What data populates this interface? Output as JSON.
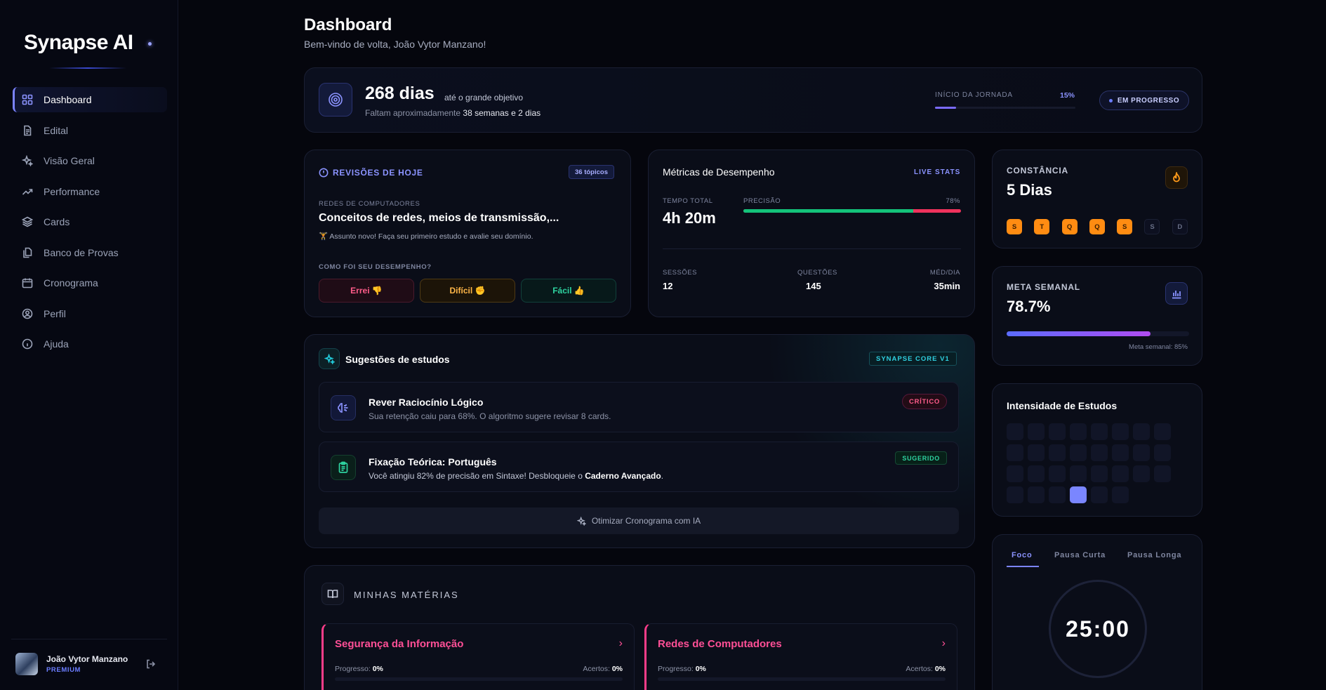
{
  "app": {
    "logo": "Synapse AI"
  },
  "sidebar": {
    "items": [
      {
        "label": "Dashboard",
        "icon": "grid-icon",
        "active": true
      },
      {
        "label": "Edital",
        "icon": "document-icon"
      },
      {
        "label": "Visão Geral",
        "icon": "sparkles-icon"
      },
      {
        "label": "Performance",
        "icon": "trending-up-icon"
      },
      {
        "label": "Cards",
        "icon": "layers-icon"
      },
      {
        "label": "Banco de Provas",
        "icon": "files-icon"
      },
      {
        "label": "Cronograma",
        "icon": "calendar-icon"
      },
      {
        "label": "Perfil",
        "icon": "user-circle-icon"
      },
      {
        "label": "Ajuda",
        "icon": "info-icon"
      }
    ],
    "user": {
      "name": "João Vytor Manzano",
      "tier": "PREMIUM"
    }
  },
  "header": {
    "title": "Dashboard",
    "subtitle": "Bem-vindo de volta, João Vytor Manzano!"
  },
  "goal": {
    "days": "268 dias",
    "until": "até o grande objetivo",
    "remaining_prefix": "Faltam aproximadamente",
    "remaining_value": "38 semanas e 2 dias",
    "journey_label": "INÍCIO DA JORNADA",
    "journey_percent": "15%",
    "journey_fraction": 0.15,
    "status": "EM PROGRESSO"
  },
  "reviews": {
    "title": "REVISÕES DE HOJE",
    "badge": "36 tópicos",
    "area": "REDES DE COMPUTADORES",
    "topic": "Conceitos de redes, meios de transmissão,...",
    "note": "🏋 Assunto novo! Faça seu primeiro estudo e avalie seu domínio.",
    "question": "COMO FOI SEU DESEMPENHO?",
    "buttons": {
      "wrong": "Errei 👎",
      "hard": "Difícil ✊",
      "easy": "Fácil 👍"
    }
  },
  "metrics": {
    "title": "Métricas de Desempenho",
    "live": "LIVE STATS",
    "total_time_label": "TEMPO TOTAL",
    "total_time": "4h 20m",
    "precision_label": "PRECISÃO",
    "precision": "78%",
    "precision_fraction": 0.78,
    "sessions_label": "SESSÕES",
    "sessions": "12",
    "questions_label": "QUESTÕES",
    "questions": "145",
    "avg_label": "MÉD/DIA",
    "avg": "35min"
  },
  "streak": {
    "label": "CONSTÂNCIA",
    "value": "5 Dias",
    "days": [
      {
        "d": "S",
        "done": true
      },
      {
        "d": "T",
        "done": true
      },
      {
        "d": "Q",
        "done": true
      },
      {
        "d": "Q",
        "done": true
      },
      {
        "d": "S",
        "done": true
      },
      {
        "d": "S",
        "done": false
      },
      {
        "d": "D",
        "done": false
      }
    ]
  },
  "weekly_goal": {
    "label": "META SEMANAL",
    "value": "78.7%",
    "fraction": 0.787,
    "note": "Meta semanal: 85%"
  },
  "intensity": {
    "title": "Intensidade de Estudos",
    "cells": [
      0,
      0,
      0,
      0,
      0,
      0,
      0,
      0,
      0,
      0,
      0,
      0,
      0,
      0,
      0,
      0,
      0,
      0,
      0,
      0,
      0,
      0,
      0,
      0,
      0,
      0,
      0,
      1,
      0,
      0
    ]
  },
  "pomodoro": {
    "tabs": [
      "Foco",
      "Pausa Curta",
      "Pausa Longa"
    ],
    "time": "25:00"
  },
  "suggestions": {
    "title": "Sugestões de estudos",
    "badge": "SYNAPSE CORE V1",
    "items": [
      {
        "title": "Rever Raciocínio Lógico",
        "desc": "Sua retenção caiu para 68%. O algoritmo sugere revisar 8 cards.",
        "tag": "CRÍTICO"
      },
      {
        "title": "Fixação Teórica: Português",
        "desc_prefix": "Você atingiu 82% de precisão em Sintaxe! Desbloqueie o",
        "desc_strong": "Caderno Avançado",
        "desc_suffix": ".",
        "tag": "SUGERIDO"
      }
    ],
    "optimize": "Otimizar Cronograma com IA"
  },
  "subjects": {
    "title": "MINHAS MATÉRIAS",
    "progress_label": "Progresso:",
    "hits_label": "Acertos:",
    "items": [
      {
        "name": "Segurança da Informação",
        "progress": "0%",
        "hits": "0%"
      },
      {
        "name": "Redes de Computadores",
        "progress": "0%",
        "hits": "0%"
      }
    ]
  },
  "colors": {
    "accent": "#7b83ff",
    "danger": "#ff5c8a",
    "warning": "#ffb648",
    "success": "#2ed3a0",
    "streak": "#ff8c12",
    "cyan": "#2fd0e0"
  }
}
